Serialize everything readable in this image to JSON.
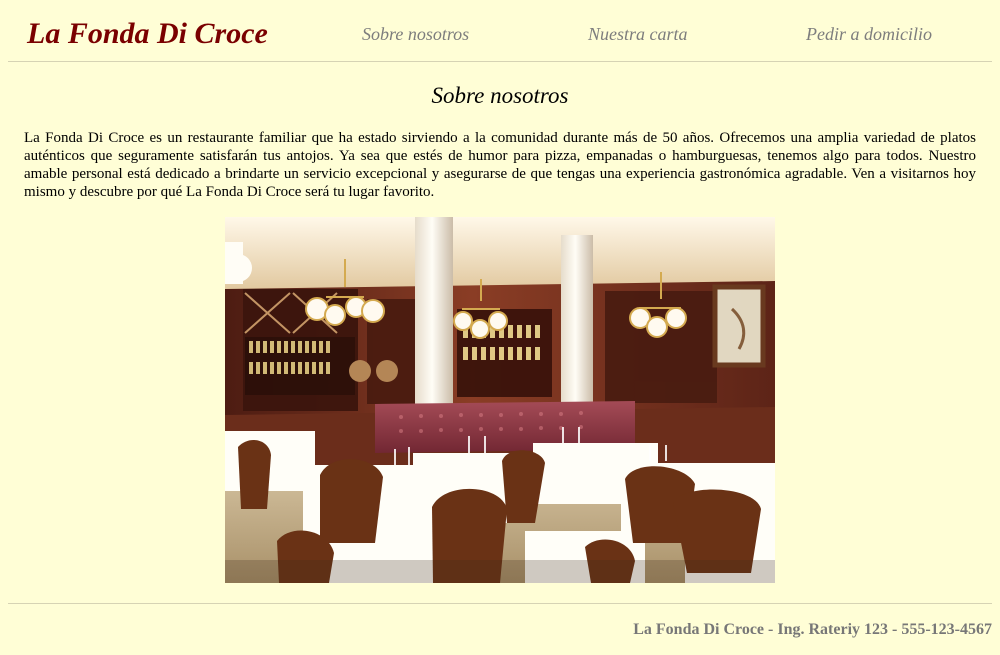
{
  "header": {
    "brand": "La Fonda Di Croce",
    "nav": [
      {
        "label": "Sobre nosotros"
      },
      {
        "label": "Nuestra carta"
      },
      {
        "label": "Pedir a domicilio"
      }
    ]
  },
  "main": {
    "title": "Sobre nosotros",
    "paragraph": "La Fonda Di Croce es un restaurante familiar que ha estado sirviendo a la comunidad durante más de 50 años. Ofrecemos una amplia variedad de platos auténticos que seguramente satisfarán tus antojos. Ya sea que estés de humor para pizza, empanadas o hamburguesas, tenemos algo para todos. Nuestro amable personal está dedicado a brindarte un servicio excepcional y asegurarse de que tengas una experiencia gastronómica agradable. Ven a visitarnos hoy mismo y descubre por qué La Fonda Di Croce será tu lugar favorito."
  },
  "footer": {
    "text": "La Fonda Di Croce - Ing. Rateriy 123 - 555-123-4567"
  }
}
